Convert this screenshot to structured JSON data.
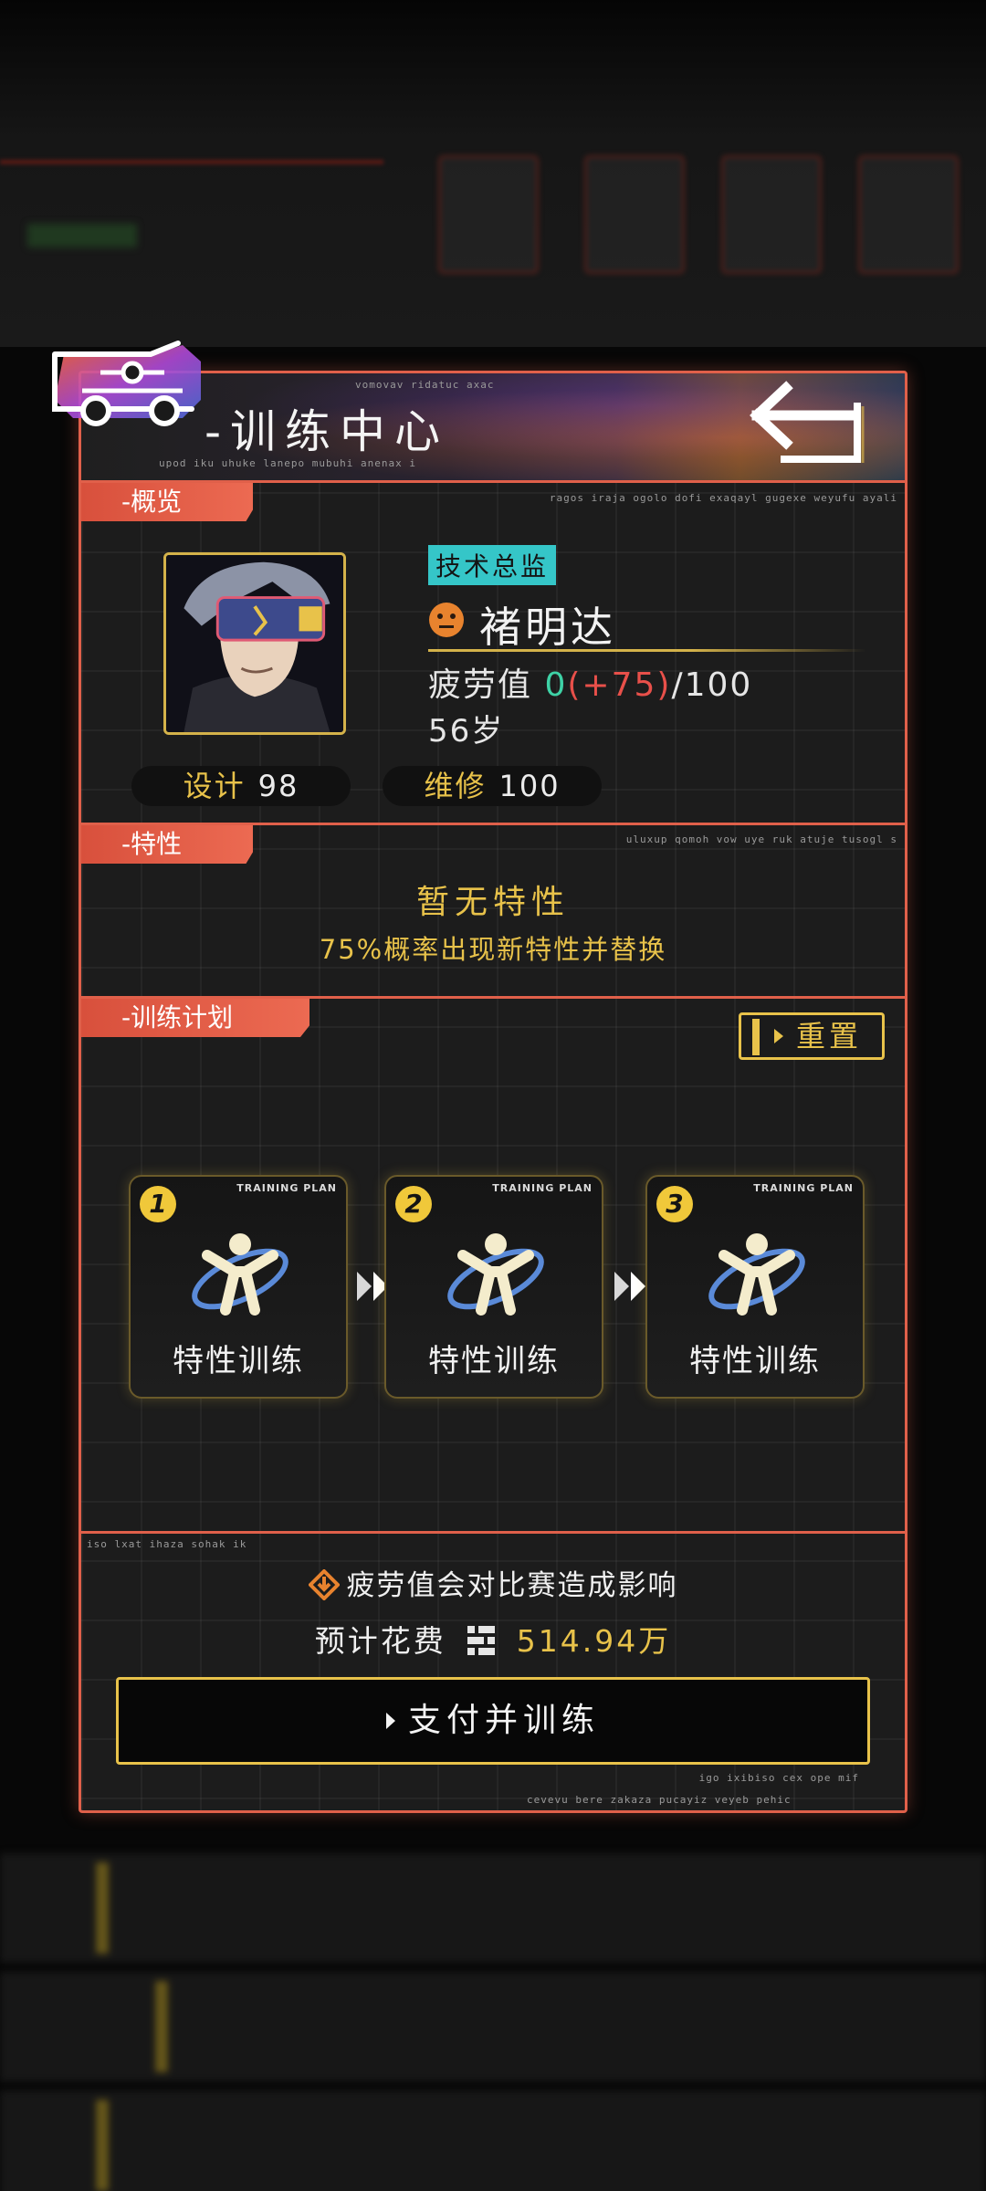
{
  "header": {
    "title": "-训练中心",
    "micro_top": "vomovav ridatuc axac",
    "micro_bottom": "upod iku uhuke lanepo mubuhi anenax i"
  },
  "sections": {
    "overview": {
      "label": "-概览",
      "micro": "ragos iraja ogolo dofi exaqayl gugexe weyufu ayali"
    },
    "traits": {
      "label": "-特性",
      "micro": "uluxup qomoh vow uye ruk atuje tusogl s"
    },
    "training": {
      "label": "-训练计划"
    }
  },
  "character": {
    "role": "技术总监",
    "name": "褚明达",
    "fatigue_label": "疲劳值",
    "fatigue_current": "0",
    "fatigue_delta": "(+75)",
    "fatigue_max": "/100",
    "age": "56岁",
    "stats": [
      {
        "label": "设计",
        "value": "98"
      },
      {
        "label": "维修",
        "value": "100"
      }
    ]
  },
  "traits": {
    "title": "暂无特性",
    "subtitle": "75%概率出现新特性并替换"
  },
  "training": {
    "reset_label": "重置",
    "plans": [
      {
        "num": "1",
        "caption": "TRAINING PLAN",
        "label": "特性训练"
      },
      {
        "num": "2",
        "caption": "TRAINING PLAN",
        "label": "特性训练"
      },
      {
        "num": "3",
        "caption": "TRAINING PLAN",
        "label": "特性训练"
      }
    ]
  },
  "footer": {
    "micro_left": "iso lxat ihaza sohak ik",
    "warning": "疲劳值会对比赛造成影响",
    "cost_label": "预计花费",
    "cost_amount": "514.94万",
    "pay_label": "支付并训练",
    "micro_right": "igo ixibiso cex ope mif",
    "micro_bottom": "cevevu bere zakaza pucayiz veyeb pehic"
  },
  "colors": {
    "accent": "#e0604a",
    "gold": "#e8c24a",
    "teal": "#35c6c8",
    "green": "#3ed2a6",
    "red": "#e8504a"
  },
  "icons": [
    "car-logo-icon",
    "back-arrow-icon",
    "neutral-face-icon",
    "training-figure-icon",
    "double-chevron-icon",
    "warning-down-icon",
    "coin-icon"
  ]
}
